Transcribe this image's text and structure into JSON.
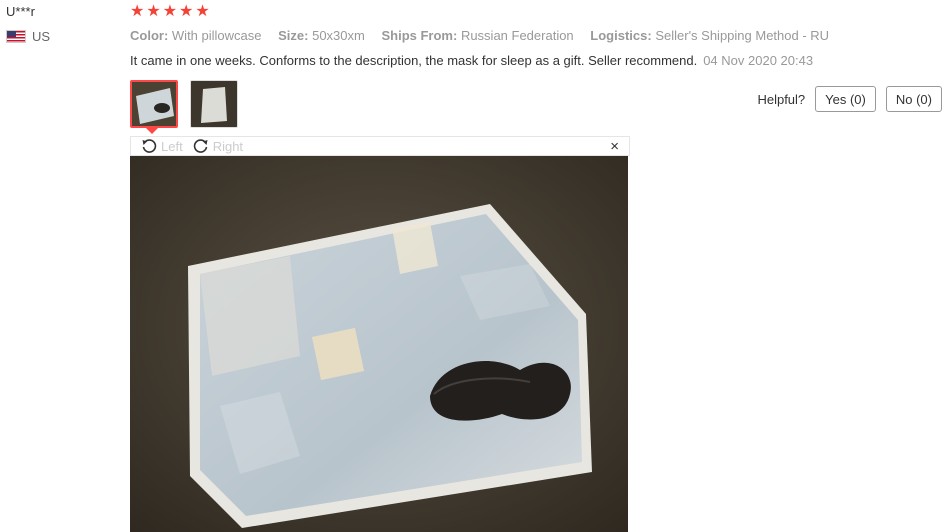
{
  "review": {
    "user": "U***r",
    "country": "US",
    "rating": 5,
    "attributes": [
      {
        "key": "Color:",
        "value": "With pillowcase"
      },
      {
        "key": "Size:",
        "value": "50x30xm"
      },
      {
        "key": "Ships From:",
        "value": "Russian Federation"
      },
      {
        "key": "Logistics:",
        "value": "Seller's Shipping Method - RU"
      }
    ],
    "text": "It came in one weeks. Conforms to the description, the mask for sleep as a gift. Seller recommend.",
    "date": "04 Nov 2020 20:43"
  },
  "helpful": {
    "label": "Helpful?",
    "yes": "Yes (0)",
    "no": "No (0)"
  },
  "viewer": {
    "rotate_left": "Left",
    "rotate_right": "Right",
    "close": "×"
  },
  "colors": {
    "star": "#f44336",
    "selected_border": "#ff4747"
  }
}
